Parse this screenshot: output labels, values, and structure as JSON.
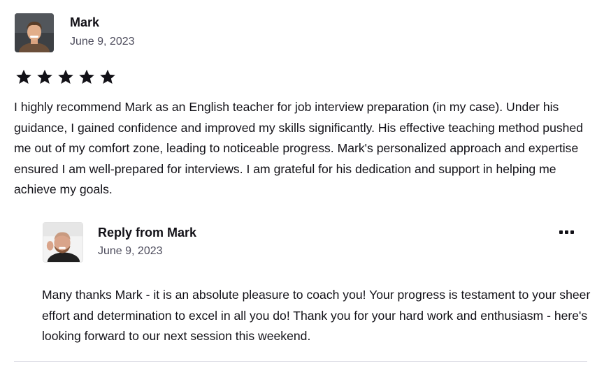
{
  "review": {
    "author": "Mark",
    "date": "June 9, 2023",
    "rating": 5,
    "rating_max": 5,
    "text": "I highly recommend Mark as an English teacher for job interview preparation (in my case). Under his guidance, I gained confidence and improved my skills significantly. His effective teaching method pushed me out of my comfort zone, leading to noticeable progress. Mark's personalized approach and expertise ensured I am well-prepared for interviews. I am grateful for his dedication and support in helping me achieve my goals."
  },
  "reply": {
    "title": "Reply from Mark",
    "date": "June 9, 2023",
    "text": "Many thanks Mark - it is an absolute pleasure to coach you! Your progress is testament to your sheer effort and determination to excel in all you do! Thank you for your hard work and enthusiasm - here's looking forward to our next session this weekend.",
    "menu_icon": "more-options-icon"
  },
  "colors": {
    "text": "#121117",
    "muted": "#4d4c5c",
    "divider": "#dcdce5"
  }
}
